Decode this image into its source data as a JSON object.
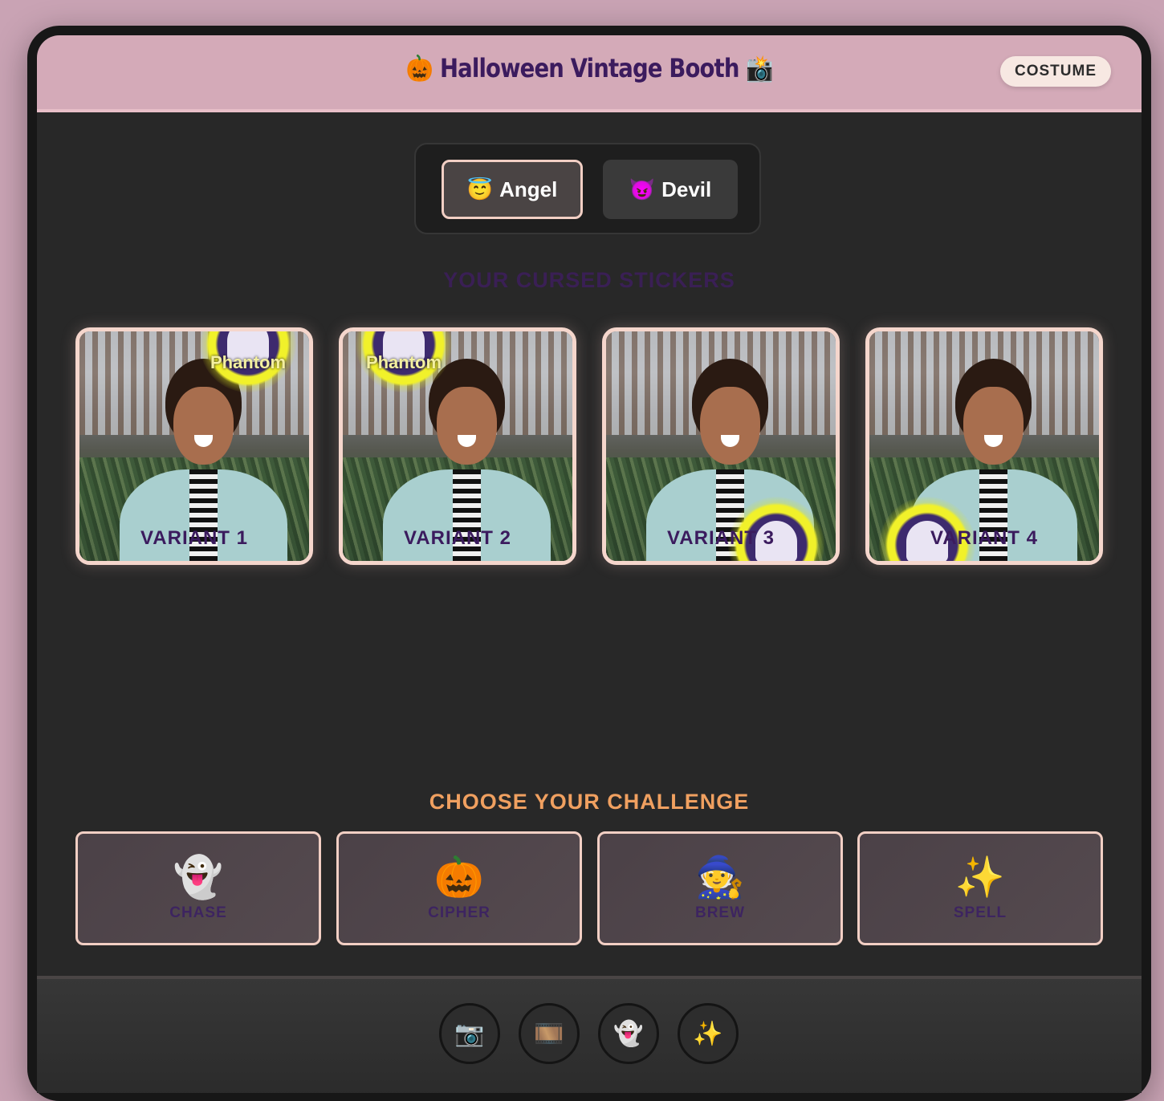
{
  "header": {
    "title": "🎃 Halloween Vintage Booth 📸",
    "costume_label": "COSTUME"
  },
  "mode_toggle": {
    "options": [
      {
        "emoji": "😇",
        "label": "Angel",
        "selected": true
      },
      {
        "emoji": "😈",
        "label": "Devil",
        "selected": false
      }
    ]
  },
  "stickers": {
    "title": "YOUR CURSED STICKERS",
    "items": [
      {
        "label": "VARIANT 1",
        "badge_text": "Phantom"
      },
      {
        "label": "VARIANT 2",
        "badge_text": "Phantom"
      },
      {
        "label": "VARIANT 3",
        "badge_text": ""
      },
      {
        "label": "VARIANT 4",
        "badge_text": ""
      }
    ]
  },
  "challenges": {
    "title": "CHOOSE YOUR CHALLENGE",
    "items": [
      {
        "icon": "👻",
        "label": "CHASE"
      },
      {
        "icon": "🎃",
        "label": "CIPHER"
      },
      {
        "icon": "🧙",
        "label": "BREW"
      },
      {
        "icon": "✨",
        "label": "SPELL"
      }
    ]
  },
  "bottom_nav": {
    "items": [
      {
        "icon": "📷",
        "name": "camera-icon"
      },
      {
        "icon": "🎞️",
        "name": "film-icon"
      },
      {
        "icon": "👻",
        "name": "ghost-icon"
      },
      {
        "icon": "✨",
        "name": "sparkles-icon"
      }
    ]
  },
  "colors": {
    "header_bg": "#d4aab8",
    "accent_border": "#f2cfc4",
    "challenge_title": "#f0a060",
    "purple_text": "#3b1b5e"
  }
}
